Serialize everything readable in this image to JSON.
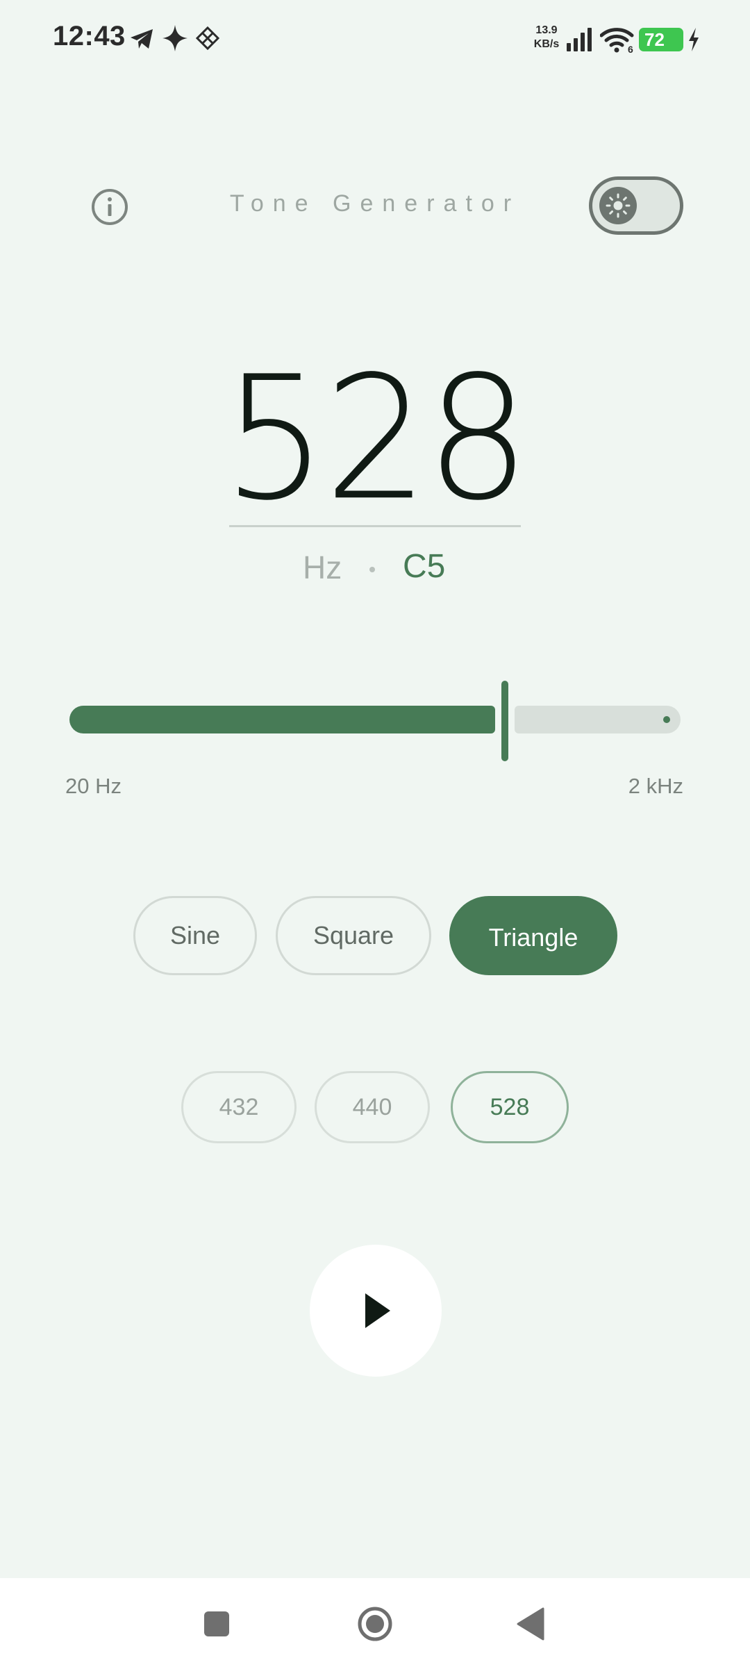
{
  "status_bar": {
    "time": "12:43",
    "net_speed_value": "13.9",
    "net_speed_unit": "KB/s",
    "wifi_badge": "6",
    "battery_level": "72",
    "icons": [
      "telegram-icon",
      "sparkle-icon",
      "grid-diamond-icon",
      "signal-icon",
      "wifi-icon",
      "battery-icon",
      "charging-bolt-icon"
    ]
  },
  "header": {
    "title": "Tone Generator",
    "info_icon": "info-icon",
    "theme_icon": "sun-icon"
  },
  "display": {
    "frequency": "528",
    "unit": "Hz",
    "separator": "·",
    "note": "C5"
  },
  "slider": {
    "min_label": "20 Hz",
    "max_label": "2 kHz",
    "min_hz": 20,
    "max_hz": 2000,
    "value_hz": 528,
    "fill_fraction": 0.713
  },
  "waveforms": {
    "options": [
      "Sine",
      "Square",
      "Triangle"
    ],
    "selected": "Triangle"
  },
  "presets": {
    "options": [
      "432",
      "440",
      "528"
    ],
    "selected": "528"
  },
  "controls": {
    "play_icon": "play-icon"
  },
  "nav": {
    "icons": [
      "recents-square-icon",
      "home-circle-icon",
      "back-triangle-icon"
    ]
  },
  "colors": {
    "background": "#f0f6f2",
    "accent": "#477b56",
    "battery": "#3ec650"
  }
}
